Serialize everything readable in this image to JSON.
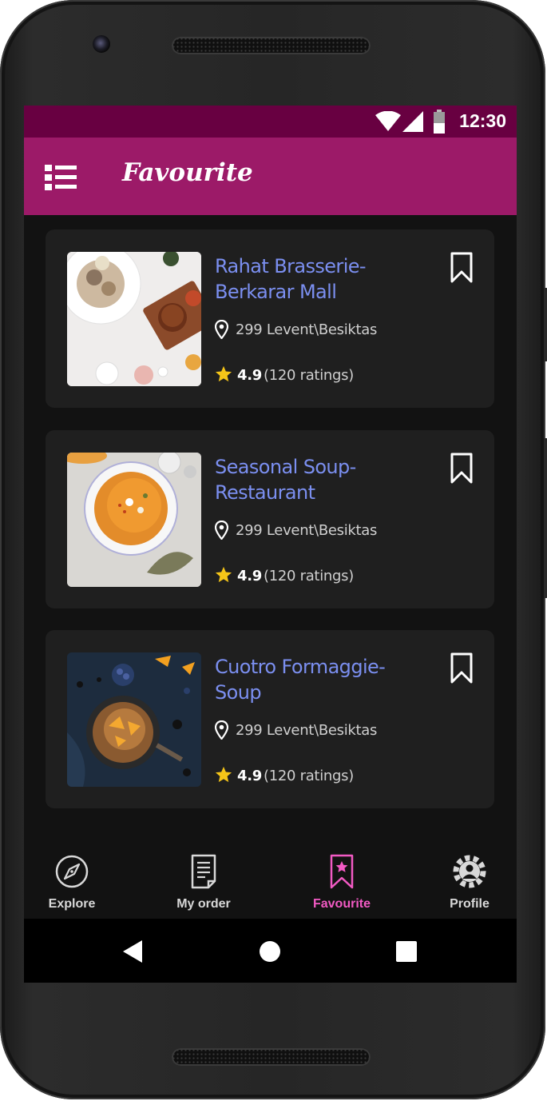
{
  "status_bar": {
    "time": "12:30"
  },
  "app_bar": {
    "title": "Favourite"
  },
  "restaurants": [
    {
      "name": "Rahat Brasserie- Berkarar Mall",
      "address": "299 Levent\\Besiktas",
      "rating": "4.9",
      "ratings_count": "(120 ratings)"
    },
    {
      "name": "Seasonal Soup- Restaurant",
      "address": "299 Levent\\Besiktas",
      "rating": "4.9",
      "ratings_count": "(120 ratings)"
    },
    {
      "name": "Cuotro Formaggie- Soup",
      "address": "299 Levent\\Besiktas",
      "rating": "4.9",
      "ratings_count": "(120 ratings)"
    }
  ],
  "bottom_nav": [
    {
      "label": "Explore",
      "icon": "compass-icon",
      "active": false
    },
    {
      "label": "My order",
      "icon": "receipt-icon",
      "active": false
    },
    {
      "label": "Favourite",
      "icon": "bookmark-star-icon",
      "active": true
    },
    {
      "label": "Profile",
      "icon": "settings-profile-icon",
      "active": false
    }
  ],
  "colors": {
    "status_bar": "#680041",
    "app_bar": "#9c1a68",
    "background": "#121212",
    "card": "#1f1f1f",
    "title_text": "#7b8ff0",
    "active_nav": "#f25ac4",
    "star": "#f5c518"
  }
}
